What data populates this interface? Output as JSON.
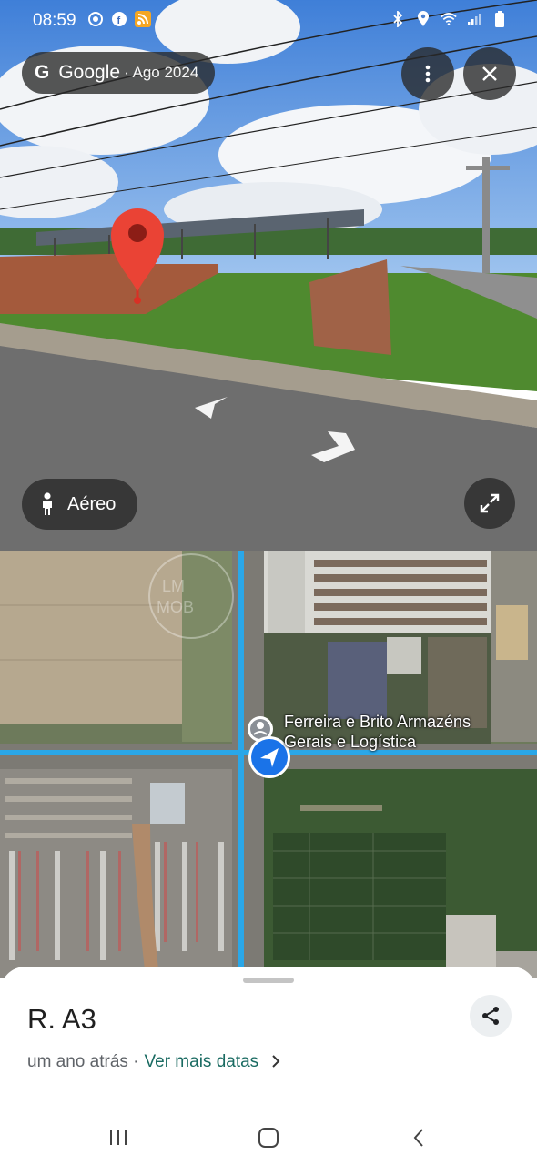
{
  "status_bar": {
    "time": "08:59",
    "left_icons": [
      "chrome-icon",
      "facebook-icon",
      "rss-icon"
    ],
    "right_icons": [
      "bluetooth-icon",
      "location-icon",
      "wifi-icon",
      "signal-icon",
      "battery-icon"
    ]
  },
  "street_view": {
    "brand": "Google",
    "capture_date": "· Ago 2024",
    "aerial_label": "Aéreo",
    "menu_icon": "more-vert-icon",
    "close_icon": "close-icon",
    "expand_icon": "expand-icon"
  },
  "map": {
    "poi_label_line1": "Ferreira e Brito Armazéns",
    "poi_label_line2": "Gerais e Logística",
    "watermark": "LM MOB",
    "colors": {
      "route": "#2aa7e8",
      "location": "#1a73e8"
    }
  },
  "sheet": {
    "title": "R. A3",
    "time_ago": "um ano atrás ·",
    "more_dates": "Ver mais datas",
    "share_icon": "share-icon"
  },
  "nav": {
    "recents_icon": "recents-icon",
    "home_icon": "home-icon",
    "back_icon": "back-icon"
  }
}
